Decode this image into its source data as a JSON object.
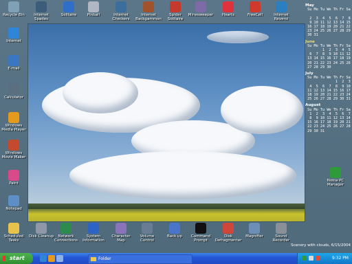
{
  "desktop": {
    "top_icons": [
      {
        "label": "Recycle Bin",
        "icon": "recycle-bin-icon",
        "color": "#7fa0b5"
      },
      {
        "label": "Internet Spades",
        "icon": "spades-icon",
        "color": "#3c5d7a"
      },
      {
        "label": "Solitaire",
        "icon": "solitaire-icon",
        "color": "#2f6fc9"
      },
      {
        "label": "Pinball",
        "icon": "pinball-icon",
        "color": "#b0b7c2"
      },
      {
        "label": "Internet Checkers",
        "icon": "checkers-icon",
        "color": "#3c6e9c"
      },
      {
        "label": "Internet Backgammon",
        "icon": "backgammon-icon",
        "color": "#a0522d"
      },
      {
        "label": "Spider Solitaire",
        "icon": "spider-icon",
        "color": "#c6392c"
      },
      {
        "label": "Minesweeper",
        "icon": "minesweeper-icon",
        "color": "#7d6aa6"
      },
      {
        "label": "Hearts",
        "icon": "hearts-icon",
        "color": "#e0323c"
      },
      {
        "label": "FreeCell",
        "icon": "freecell-icon",
        "color": "#d03a2a"
      },
      {
        "label": "Internet Reversi",
        "icon": "reversi-icon",
        "color": "#2b7fc1"
      }
    ],
    "left_icons": [
      {
        "label": "Internet",
        "icon": "internet-explorer-icon",
        "color": "#2f86d8"
      },
      {
        "label": "E-mail",
        "icon": "email-icon",
        "color": "#3977c2"
      },
      {
        "label": "Calculator",
        "icon": "calculator-icon",
        "color": "#5b6f80"
      },
      {
        "label": "Windows Media Player",
        "icon": "media-player-icon",
        "color": "#e49a1d"
      },
      {
        "label": "Windows Movie Maker",
        "icon": "movie-maker-icon",
        "color": "#c54a2d"
      },
      {
        "label": "Paint",
        "icon": "paint-icon",
        "color": "#d84a8a"
      },
      {
        "label": "Notepad",
        "icon": "notepad-icon",
        "color": "#5d8fc6"
      }
    ],
    "bottom_icons": [
      {
        "label": "Scheduled Tasks",
        "icon": "scheduled-tasks-icon",
        "color": "#e7c34b"
      },
      {
        "label": "Disk Cleanup",
        "icon": "disk-cleanup-icon",
        "color": "#8e98a6"
      },
      {
        "label": "Network Connections",
        "icon": "network-icon",
        "color": "#2f8a4f"
      },
      {
        "label": "System Information",
        "icon": "system-info-icon",
        "color": "#2e63c6"
      },
      {
        "label": "Character Map",
        "icon": "character-map-icon",
        "color": "#8a74b8"
      },
      {
        "label": "Volume Control",
        "icon": "volume-icon",
        "color": "#6a7c93"
      },
      {
        "label": "Back up",
        "icon": "backup-icon",
        "color": "#4a75c8"
      },
      {
        "label": "Command Prompt",
        "icon": "command-prompt-icon",
        "color": "#111111"
      },
      {
        "label": "Disk Defragmenter",
        "icon": "defragmenter-icon",
        "color": "#d1463b"
      },
      {
        "label": "Magnifier",
        "icon": "magnifier-icon",
        "color": "#6d8fb5"
      },
      {
        "label": "Sound Recorder",
        "icon": "sound-recorder-icon",
        "color": "#8a8f98"
      }
    ],
    "right_icon": {
      "label": "Nokia PC Manager",
      "icon": "nokia-pc-manager-icon",
      "color": "#2f9a3a"
    },
    "wallpaper_caption": "Scenery with clouds, 6/15/2004"
  },
  "calendar": {
    "header": [
      "Su",
      "Mo",
      "Tu",
      "We",
      "Th",
      "Fr",
      "Sa"
    ],
    "months": [
      {
        "name": "May",
        "highlight": false,
        "weeks": [
          [
            "",
            "",
            "",
            "",
            "",
            "",
            ""
          ],
          [
            "2",
            "3",
            "4",
            "5",
            "6",
            "7",
            "8"
          ],
          [
            "9",
            "10",
            "11",
            "12",
            "13",
            "14",
            "15"
          ],
          [
            "16",
            "17",
            "18",
            "19",
            "20",
            "21",
            "22"
          ],
          [
            "23",
            "24",
            "25",
            "26",
            "27",
            "28",
            "29"
          ],
          [
            "30",
            "31",
            "",
            "",
            "",
            "",
            ""
          ]
        ]
      },
      {
        "name": "June",
        "highlight": true,
        "weeks": [
          [
            "",
            "",
            "1",
            "2",
            "3",
            "4",
            "5"
          ],
          [
            "6",
            "7",
            "8",
            "9",
            "10",
            "11",
            "12"
          ],
          [
            "13",
            "14",
            "15",
            "16",
            "17",
            "18",
            "19"
          ],
          [
            "20",
            "21",
            "22",
            "23",
            "24",
            "25",
            "26"
          ],
          [
            "27",
            "28",
            "29",
            "30",
            "",
            "",
            ""
          ]
        ]
      },
      {
        "name": "July",
        "highlight": false,
        "weeks": [
          [
            "",
            "",
            "",
            "",
            "1",
            "2",
            "3"
          ],
          [
            "4",
            "5",
            "6",
            "7",
            "8",
            "9",
            "10"
          ],
          [
            "11",
            "12",
            "13",
            "14",
            "15",
            "16",
            "17"
          ],
          [
            "18",
            "19",
            "20",
            "21",
            "22",
            "23",
            "24"
          ],
          [
            "25",
            "26",
            "27",
            "28",
            "29",
            "30",
            "31"
          ]
        ]
      },
      {
        "name": "August",
        "highlight": false,
        "weeks": [
          [
            "1",
            "2",
            "3",
            "4",
            "5",
            "6",
            "7"
          ],
          [
            "8",
            "9",
            "10",
            "11",
            "12",
            "13",
            "14"
          ],
          [
            "15",
            "16",
            "17",
            "18",
            "19",
            "20",
            "21"
          ],
          [
            "22",
            "23",
            "24",
            "25",
            "26",
            "27",
            "28"
          ],
          [
            "29",
            "30",
            "31",
            "",
            "",
            "",
            ""
          ]
        ]
      }
    ]
  },
  "taskbar": {
    "start_label": "start",
    "quick_launch": [
      {
        "icon": "ie-quicklaunch-icon",
        "color": "#2f86d8"
      },
      {
        "icon": "media-player-quicklaunch-icon",
        "color": "#e49a1d"
      },
      {
        "icon": "show-desktop-icon",
        "color": "#8fb2e6"
      }
    ],
    "window_button": "Folder",
    "tray_icons": [
      {
        "icon": "network-tray-icon",
        "color": "#2d9a43"
      },
      {
        "icon": "volume-tray-icon",
        "color": "#d8d8d8"
      },
      {
        "icon": "security-tray-icon",
        "color": "#e84a3a"
      }
    ],
    "clock": "9:32 PM"
  }
}
